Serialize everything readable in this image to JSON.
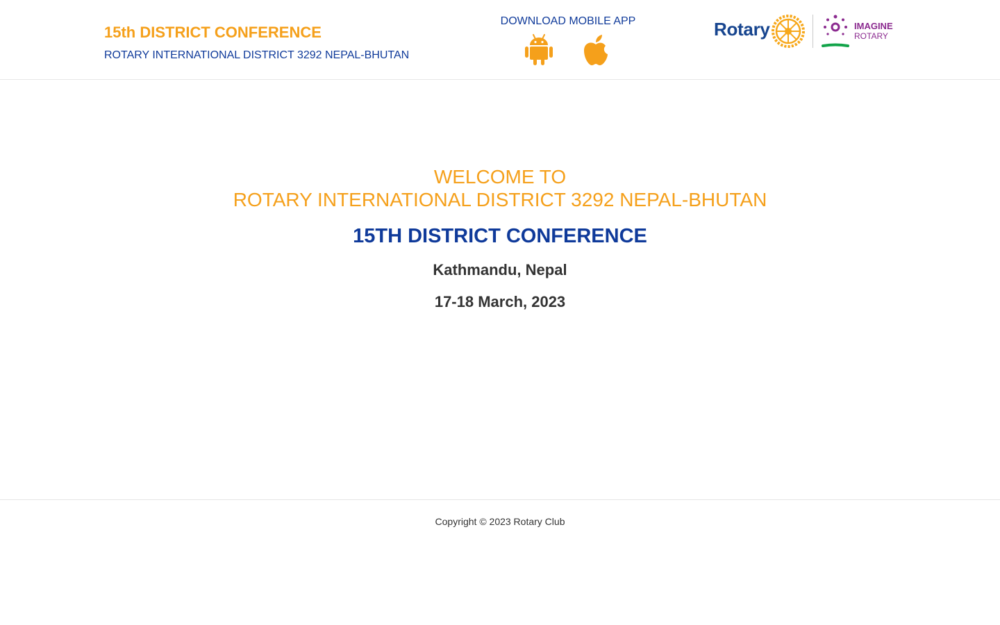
{
  "colors": {
    "accent_orange": "#f5a01b",
    "brand_blue": "#0f3a9a",
    "rotary_blue": "#17458f",
    "rotary_gold": "#f7a81b",
    "imagine_purple": "#8b2a8f",
    "imagine_green": "#13a44a",
    "text_dark": "#333333"
  },
  "header": {
    "title": "15th DISTRICT CONFERENCE",
    "subtitle": "ROTARY INTERNATIONAL DISTRICT 3292 NEPAL-BHUTAN",
    "app": {
      "heading": "DOWNLOAD MOBILE APP",
      "icons": [
        "android-icon",
        "apple-icon"
      ]
    },
    "logos": {
      "rotary_word": "Rotary",
      "imagine_word": "IMAGINE",
      "imagine_rotary": "ROTARY"
    }
  },
  "main": {
    "welcome_line1": "WELCOME TO",
    "welcome_line2": "ROTARY INTERNATIONAL DISTRICT 3292 NEPAL-BHUTAN",
    "conference_title": "15TH DISTRICT CONFERENCE",
    "location": "Kathmandu, Nepal",
    "date": "17-18 March, 2023"
  },
  "footer": {
    "copyright": "Copyright © 2023 Rotary Club"
  }
}
